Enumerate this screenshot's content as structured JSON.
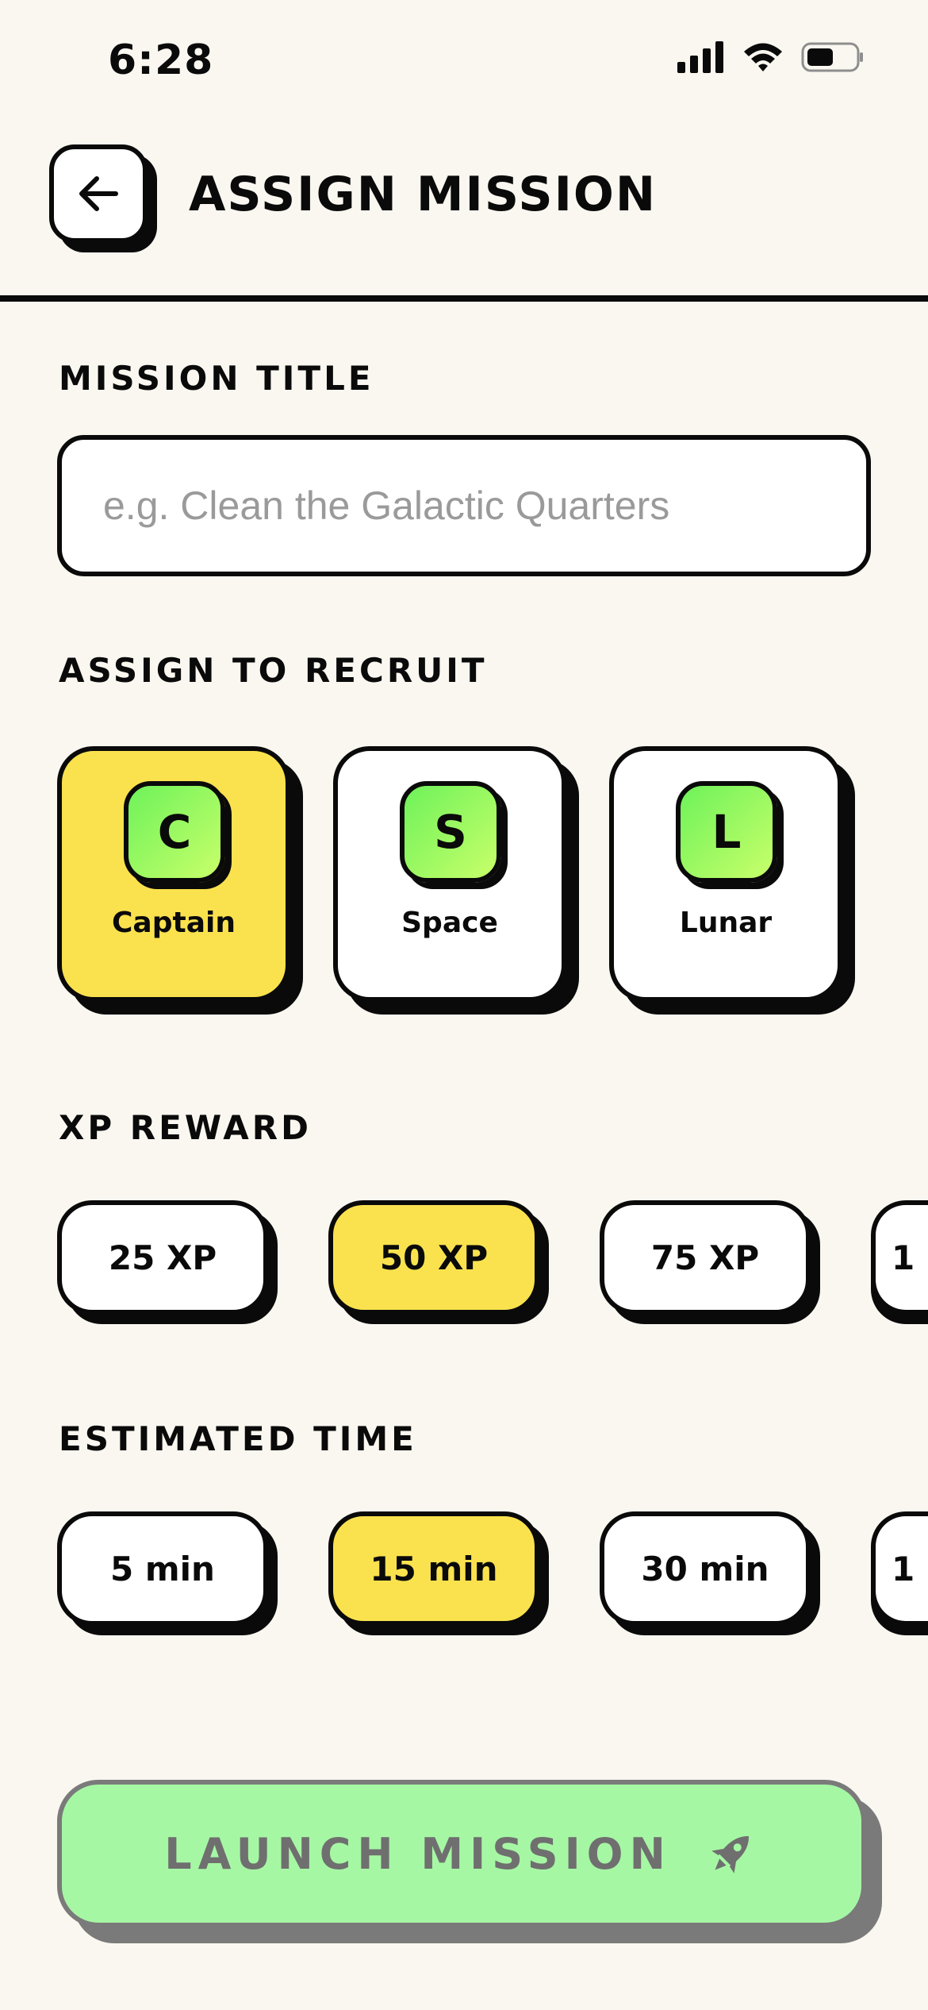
{
  "status_bar": {
    "time": "6:28",
    "icons": [
      "cellular-signal-icon",
      "wifi-icon",
      "battery-icon"
    ]
  },
  "header": {
    "title": "ASSIGN MISSION",
    "back_icon": "arrow-left-icon"
  },
  "mission_title": {
    "label": "MISSION TITLE",
    "value": "",
    "placeholder": "e.g. Clean the Galactic Quarters"
  },
  "recruits": {
    "label": "ASSIGN TO RECRUIT",
    "items": [
      {
        "initial": "C",
        "name": "Captain",
        "selected": true
      },
      {
        "initial": "S",
        "name": "Space",
        "selected": false
      },
      {
        "initial": "L",
        "name": "Lunar",
        "selected": false
      }
    ]
  },
  "xp_reward": {
    "label": "XP REWARD",
    "options": [
      "25 XP",
      "50 XP",
      "75 XP",
      "1"
    ],
    "selected": "50 XP"
  },
  "estimated_time": {
    "label": "ESTIMATED TIME",
    "options": [
      "5 min",
      "15 min",
      "30 min",
      "1"
    ],
    "selected": "15 min"
  },
  "launch": {
    "label": "LAUNCH MISSION",
    "icon": "rocket-icon",
    "enabled": false
  },
  "colors": {
    "background": "#FAF7F0",
    "accent_yellow": "#FAE24E",
    "avatar_green": "#6EF25A",
    "launch_green": "#A6F7A4",
    "ink": "#0A0A0A"
  }
}
